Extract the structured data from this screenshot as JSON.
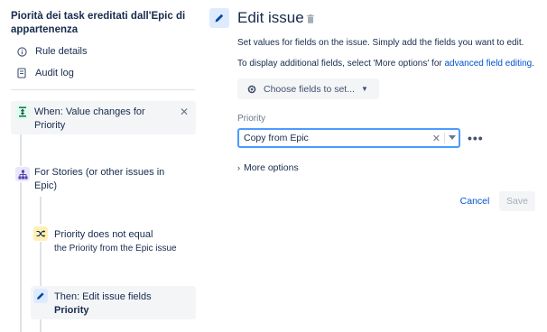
{
  "sidebar": {
    "rule_title": "Piorità dei task ereditati dall'Epic di appartenenza",
    "links": [
      {
        "label": "Rule details",
        "icon": "info-icon"
      },
      {
        "label": "Audit log",
        "icon": "document-icon"
      }
    ],
    "trigger": {
      "label": "When: Value changes for",
      "sub": "Priority",
      "icon": "field-change-icon",
      "color": "#e3fcef"
    },
    "branch": {
      "label": "For Stories (or other issues in Epic)",
      "icon": "hierarchy-icon",
      "color": "#eae6ff"
    },
    "condition": {
      "label": "Priority does not equal",
      "sub": "the Priority from the Epic issue",
      "icon": "shuffle-icon",
      "color": "#fff0b3"
    },
    "action": {
      "label": "Then: Edit issue fields",
      "sub": "Priority",
      "icon": "pencil-icon",
      "color": "#deebff"
    }
  },
  "main": {
    "title": "Edit issue",
    "desc1": "Set values for fields on the issue. Simply add the fields you want to edit.",
    "desc2_prefix": "To display additional fields, select 'More options' for ",
    "desc2_link": "advanced field editing",
    "desc2_suffix": ".",
    "choose_fields": "Choose fields to set...",
    "field_label": "Priority",
    "field_value": "Copy from Epic",
    "more_options": "More options",
    "cancel": "Cancel",
    "save": "Save"
  }
}
